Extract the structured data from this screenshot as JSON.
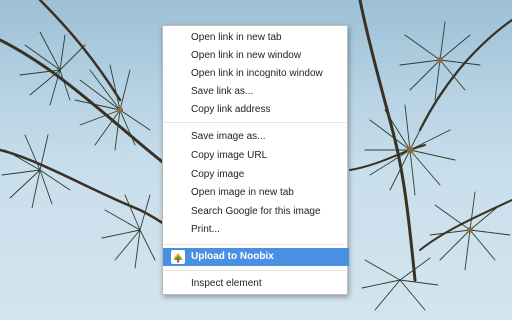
{
  "colors": {
    "highlight": "#4a90e2",
    "menu_bg": "#ffffff",
    "sky": "#c9dfec"
  },
  "menu": {
    "group1": [
      "Open link in new tab",
      "Open link in new window",
      "Open link in incognito window",
      "Save link as...",
      "Copy link address"
    ],
    "group2": [
      "Save image as...",
      "Copy image URL",
      "Copy image",
      "Open image in new tab",
      "Search Google for this image",
      "Print..."
    ],
    "extension_item": {
      "label": "Upload to Noobix",
      "icon": "noobix-icon"
    },
    "inspect_label": "Inspect element"
  }
}
